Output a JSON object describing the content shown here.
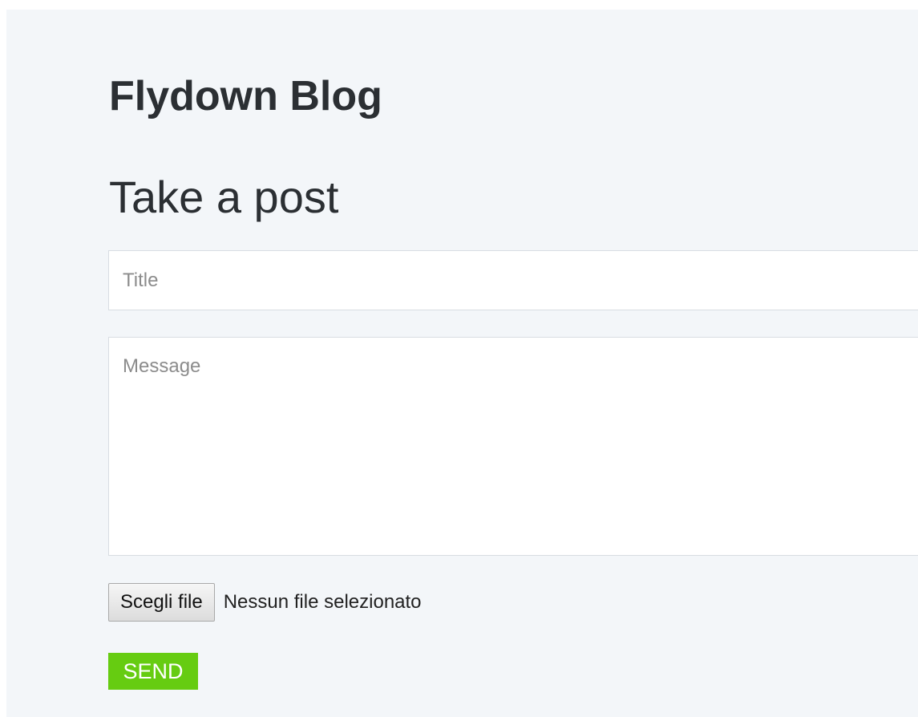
{
  "header": {
    "blog_title": "Flydown Blog"
  },
  "form": {
    "heading": "Take a post",
    "title_field": {
      "placeholder": "Title",
      "value": ""
    },
    "message_field": {
      "placeholder": "Message",
      "value": ""
    },
    "file_picker": {
      "button_label": "Scegli file",
      "status_text": "Nessun file selezionato"
    },
    "send_label": "SEND"
  },
  "colors": {
    "panel_background": "#f3f6f9",
    "send_button": "#66cc11",
    "text": "#2b2f33"
  }
}
